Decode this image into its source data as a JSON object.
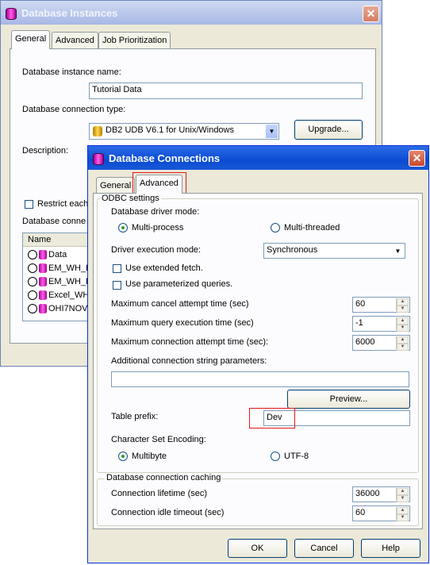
{
  "back_window": {
    "title": "Database Instances",
    "tabs": [
      "General",
      "Advanced",
      "Job Prioritization"
    ],
    "instance_name_label": "Database instance name:",
    "instance_name_value": "Tutorial Data",
    "connection_type_label": "Database connection type:",
    "connection_type_value": "DB2 UDB V6.1 for Unix/Windows",
    "upgrade_label": "Upgrade...",
    "description_label": "Description:",
    "restrict_label": "Restrict each",
    "connection_label": "Database conne",
    "list_header": "Name",
    "list_items": [
      "Data",
      "EM_WH_E",
      "EM_WH_E",
      "Excel_WH",
      "OHI7NOV"
    ]
  },
  "front_window": {
    "title": "Database Connections",
    "tabs": [
      "General",
      "Advanced"
    ],
    "odbc_group_title": "ODBC settings",
    "driver_mode_label": "Database driver mode:",
    "driver_mode_options": [
      "Multi-process",
      "Multi-threaded"
    ],
    "driver_mode_selected": "Multi-process",
    "exec_mode_label": "Driver execution mode:",
    "exec_mode_value": "Synchronous",
    "extended_fetch_label": "Use extended fetch.",
    "param_queries_label": "Use parameterized queries.",
    "cancel_time_label": "Maximum cancel attempt time (sec)",
    "cancel_time_value": "60",
    "query_time_label": "Maximum query execution time (sec)",
    "query_time_value": "-1",
    "conn_time_label": "Maximum connection attempt time (sec):",
    "conn_time_value": "6000",
    "additional_params_label": "Additional connection string parameters:",
    "additional_params_value": "",
    "preview_label": "Preview...",
    "table_prefix_label": "Table prefix:",
    "table_prefix_value": "Dev",
    "encoding_label": "Character Set Encoding:",
    "encoding_options": [
      "Multibyte",
      "UTF-8"
    ],
    "encoding_selected": "Multibyte",
    "caching_group_title": "Database connection caching",
    "lifetime_label": "Connection lifetime (sec)",
    "lifetime_value": "36000",
    "idle_label": "Connection idle timeout (sec)",
    "idle_value": "60",
    "ok_label": "OK",
    "cancel_label": "Cancel",
    "help_label": "Help"
  },
  "colors": {
    "window_bg": "#ece9d8",
    "active_title": "#0a4bd2",
    "inactive_title": "#a7b8e6",
    "highlight_box": "#e01818"
  }
}
